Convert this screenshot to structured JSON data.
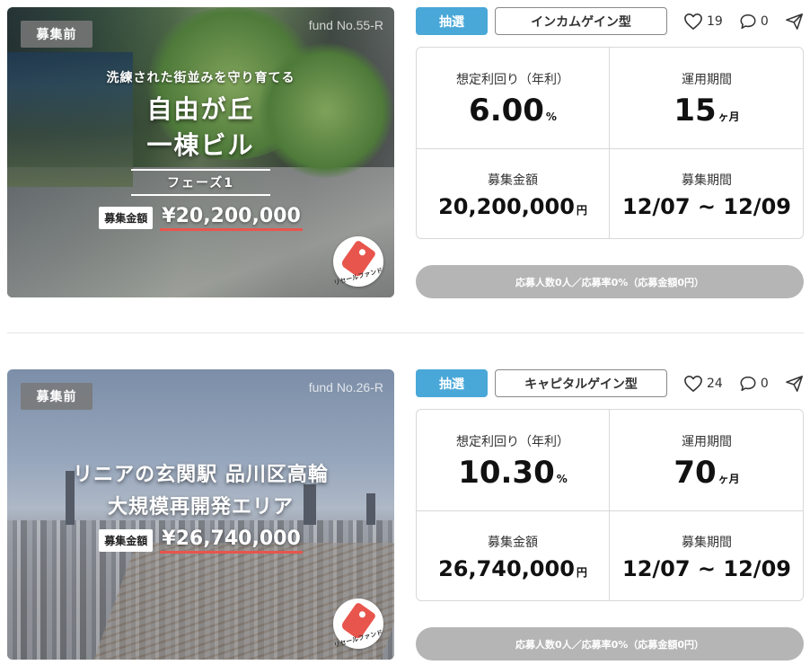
{
  "funds": [
    {
      "status": "募集前",
      "fund_no": "fund No.55-R",
      "subtitle": "洗練された街並みを守り育てる",
      "title_line1": "自由が丘",
      "title_line2": "一棟ビル",
      "phase": "フェーズ1",
      "amount_tag": "募集金額",
      "amount_display": "¥20,200,000",
      "resale_label": "リセールファンド",
      "lottery": "抽選",
      "type": "インカムゲイン型",
      "likes": "19",
      "comments": "0",
      "yield_label": "想定利回り（年利）",
      "yield_value": "6.00",
      "yield_unit": "%",
      "period_label": "運用期間",
      "period_value": "15",
      "period_unit": "ヶ月",
      "raise_label": "募集金額",
      "raise_value": "20,200,000",
      "raise_unit": "円",
      "window_label": "募集期間",
      "window_value": "12/07 ~ 12/09",
      "progress_text": "応募人数0人／応募率0%（応募金額0円）",
      "progress_rate": 0
    },
    {
      "status": "募集前",
      "fund_no": "fund No.26-R",
      "title_line1": "リニアの玄関駅 品川区高輪",
      "title_line2": "大規模再開発エリア",
      "amount_tag": "募集金額",
      "amount_display": "¥26,740,000",
      "resale_label": "リセールファンド",
      "lottery": "抽選",
      "type": "キャピタルゲイン型",
      "likes": "24",
      "comments": "0",
      "yield_label": "想定利回り（年利）",
      "yield_value": "10.30",
      "yield_unit": "%",
      "period_label": "運用期間",
      "period_value": "70",
      "period_unit": "ヶ月",
      "raise_label": "募集金額",
      "raise_value": "26,740,000",
      "raise_unit": "円",
      "window_label": "募集期間",
      "window_value": "12/07 ~ 12/09",
      "progress_text": "応募人数0人／応募率0%（応募金額0円）",
      "progress_rate": 0
    }
  ],
  "icons": {
    "like": "heart-icon",
    "comment": "comment-bubble-icon",
    "share": "send-arrow-icon"
  },
  "colors": {
    "lottery": "#4aa8d8",
    "accent_underline": "#e8554d",
    "progress_bg": "#b5b5b5"
  }
}
